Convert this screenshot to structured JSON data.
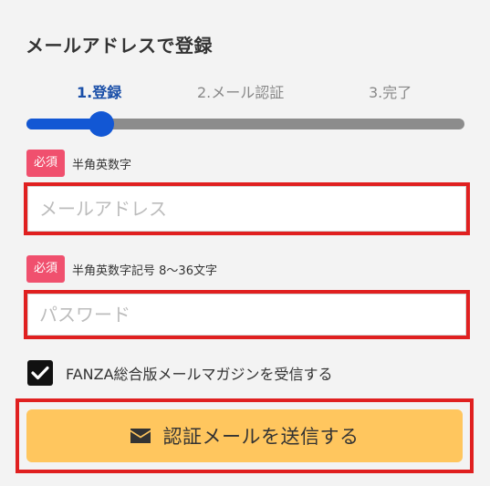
{
  "page": {
    "title": "メールアドレスで登録"
  },
  "steps": [
    {
      "label": "1.登録",
      "active": true
    },
    {
      "label": "2.メール認証",
      "active": false
    },
    {
      "label": "3.完了",
      "active": false
    }
  ],
  "progress": {
    "fraction": 0.17
  },
  "email": {
    "badge": "必須",
    "hint": "半角英数字",
    "placeholder": "メールアドレス",
    "value": ""
  },
  "password": {
    "badge": "必須",
    "hint": "半角英数字記号 8～36文字",
    "placeholder": "パスワード",
    "value": ""
  },
  "newsletter": {
    "label": "FANZA総合版メールマガジンを受信する",
    "checked": true
  },
  "submit": {
    "label": "認証メールを送信する",
    "icon": "envelope-icon"
  },
  "colors": {
    "accent": "#1257d4",
    "required": "#f0506e",
    "highlight": "#e02020",
    "button": "#ffc65e"
  }
}
